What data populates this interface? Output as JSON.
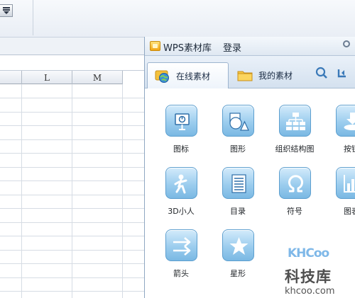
{
  "spreadsheet": {
    "columns": [
      {
        "label": ""
      },
      {
        "label": "L"
      },
      {
        "label": "M"
      }
    ]
  },
  "panel": {
    "title": "WPS素材库",
    "login": "登录",
    "tabs": [
      {
        "label": "在线素材",
        "icon": "globe-folder-icon",
        "active": true
      },
      {
        "label": "我的素材",
        "icon": "folder-icon",
        "active": false
      }
    ],
    "tools": [
      {
        "icon": "search-icon"
      },
      {
        "icon": "refresh-icon"
      }
    ],
    "items": [
      {
        "label": "图标",
        "icon": "presentation-board-icon"
      },
      {
        "label": "图形",
        "icon": "shapes-icon"
      },
      {
        "label": "组织结构图",
        "icon": "org-chart-icon"
      },
      {
        "label": "按钮",
        "icon": "download-button-icon"
      },
      {
        "label": "3D小人",
        "icon": "3d-figure-icon"
      },
      {
        "label": "目录",
        "icon": "list-document-icon"
      },
      {
        "label": "符号",
        "icon": "omega-symbol-icon"
      },
      {
        "label": "图表",
        "icon": "bar-chart-icon"
      },
      {
        "label": "箭头",
        "icon": "arrows-icon"
      },
      {
        "label": "星形",
        "icon": "star-icon"
      }
    ]
  },
  "watermark": {
    "badge": "KHCoo",
    "name": "科技库",
    "url": "khcoo.com"
  },
  "colors": {
    "tile_top": "#d3ebfb",
    "tile_bottom": "#7ab8e3",
    "tile_border": "#5d9fcf",
    "panel_border": "#8fa7c2",
    "folder_yellow": "#f2b632"
  }
}
